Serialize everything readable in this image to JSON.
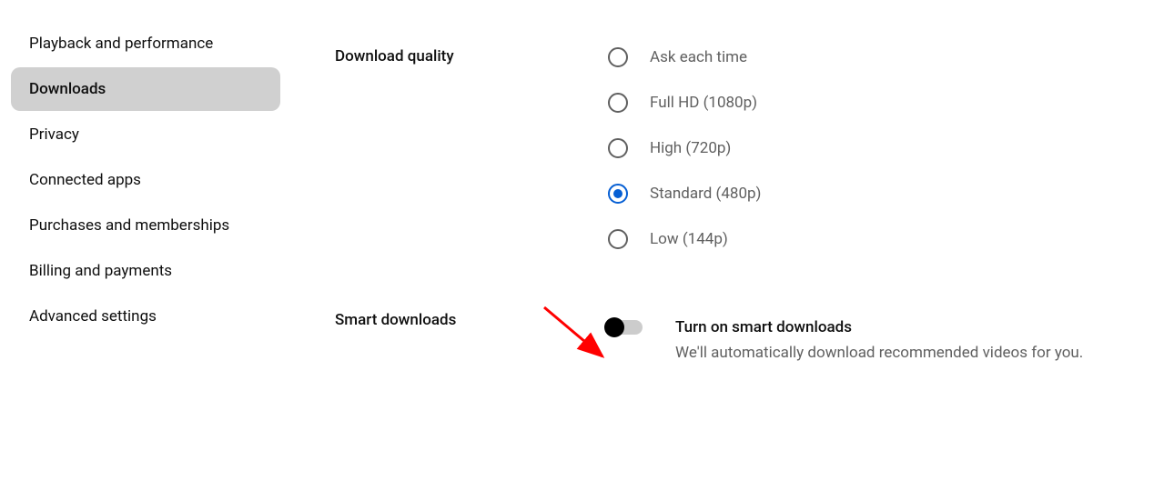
{
  "sidebar": {
    "items": [
      {
        "label": "Playback and performance",
        "active": false
      },
      {
        "label": "Downloads",
        "active": true
      },
      {
        "label": "Privacy",
        "active": false
      },
      {
        "label": "Connected apps",
        "active": false
      },
      {
        "label": "Purchases and memberships",
        "active": false
      },
      {
        "label": "Billing and payments",
        "active": false
      },
      {
        "label": "Advanced settings",
        "active": false
      }
    ]
  },
  "sections": {
    "download_quality": {
      "label": "Download quality",
      "options": [
        {
          "label": "Ask each time",
          "selected": false
        },
        {
          "label": "Full HD (1080p)",
          "selected": false
        },
        {
          "label": "High (720p)",
          "selected": false
        },
        {
          "label": "Standard (480p)",
          "selected": true
        },
        {
          "label": "Low (144p)",
          "selected": false
        }
      ]
    },
    "smart_downloads": {
      "label": "Smart downloads",
      "toggle_title": "Turn on smart downloads",
      "toggle_desc": "We'll automatically download recommended videos for you.",
      "enabled": false
    }
  }
}
